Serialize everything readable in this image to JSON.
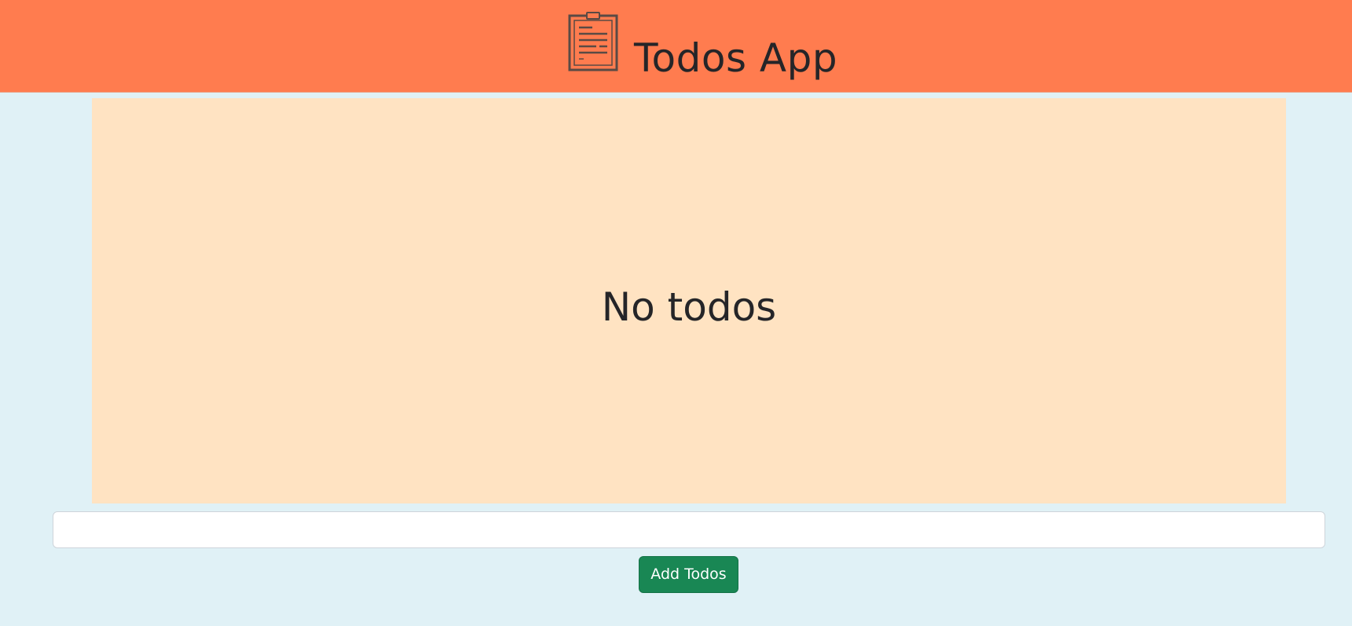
{
  "header": {
    "title": "Todos App",
    "logo_icon": "clipboard-icon",
    "background_color": "#ff7c4f"
  },
  "todos": {
    "empty_message": "No todos",
    "items": [],
    "panel_color": "#ffe3c2"
  },
  "form": {
    "input_value": "",
    "input_placeholder": "",
    "add_button_label": "Add Todos",
    "button_color": "#198754"
  },
  "page": {
    "background_color": "#e0f1f6"
  }
}
